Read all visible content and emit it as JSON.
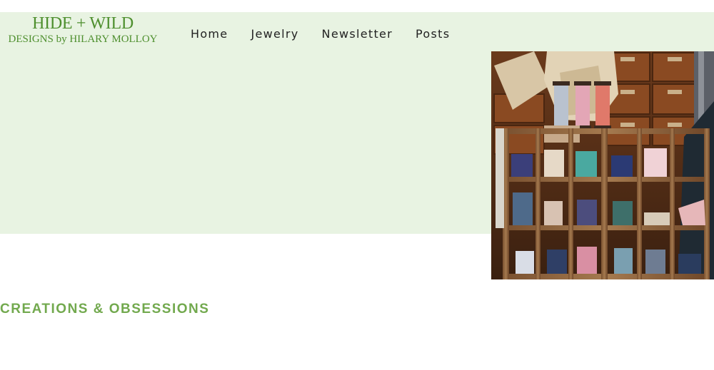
{
  "header": {
    "logo_title": "HIDE + WILD",
    "logo_subtitle": "DESIGNS by HILARY MOLLOY",
    "nav": [
      {
        "label": "Home"
      },
      {
        "label": "Jewelry"
      },
      {
        "label": "Newsletter"
      },
      {
        "label": "Posts"
      }
    ]
  },
  "hero": {
    "band_color": "#e8f3e2",
    "image_subject": "wooden cubby shelf holding spools of ribbon and twine"
  },
  "main": {
    "section_heading": "CREATIONS & OBSESSIONS"
  },
  "colors": {
    "brand_green": "#4e8f2e",
    "heading_green": "#72a94e",
    "nav_text": "#222222"
  }
}
